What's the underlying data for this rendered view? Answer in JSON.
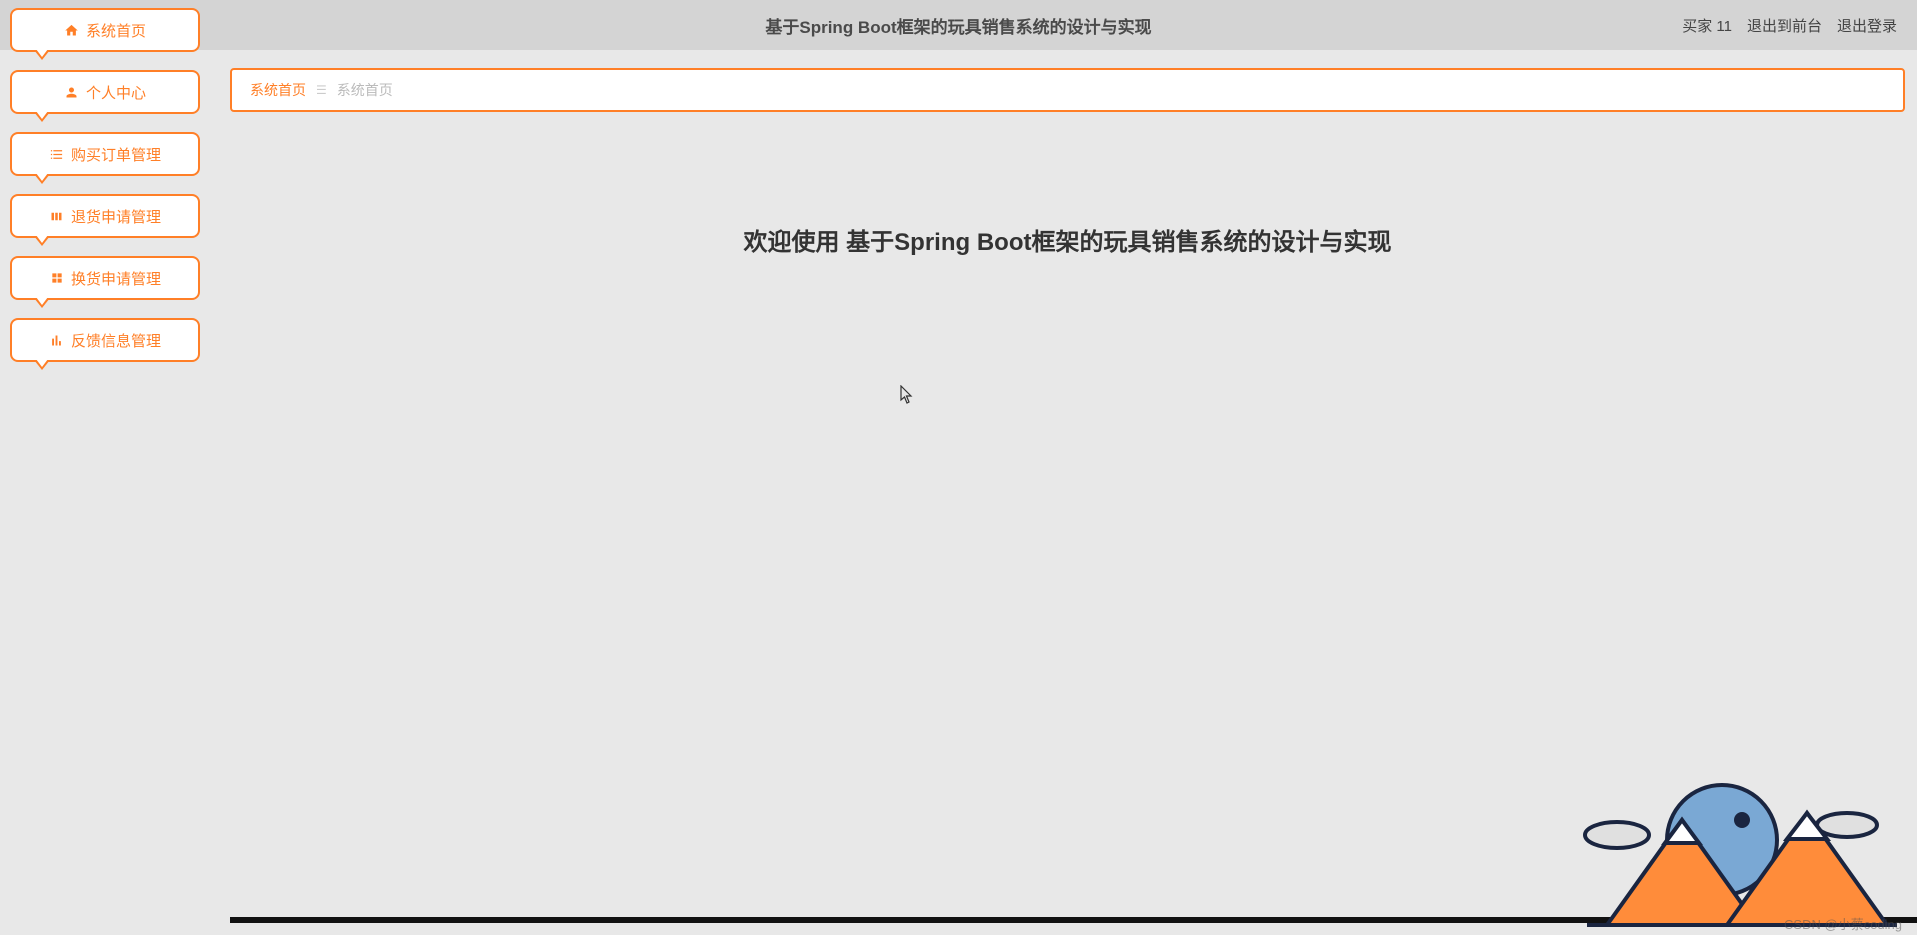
{
  "header": {
    "title": "基于Spring Boot框架的玩具销售系统的设计与实现",
    "user_label": "买家 11",
    "exit_front": "退出到前台",
    "logout": "退出登录"
  },
  "sidebar": {
    "items": [
      {
        "label": "系统首页",
        "icon": "home"
      },
      {
        "label": "个人中心",
        "icon": "user"
      },
      {
        "label": "购买订单管理",
        "icon": "list"
      },
      {
        "label": "退货申请管理",
        "icon": "package"
      },
      {
        "label": "换货申请管理",
        "icon": "grid"
      },
      {
        "label": "反馈信息管理",
        "icon": "chart"
      }
    ]
  },
  "breadcrumb": {
    "first": "系统首页",
    "second": "系统首页"
  },
  "main": {
    "welcome": "欢迎使用 基于Spring Boot框架的玩具销售系统的设计与实现"
  },
  "watermark": "CSDN @小蔡coding"
}
